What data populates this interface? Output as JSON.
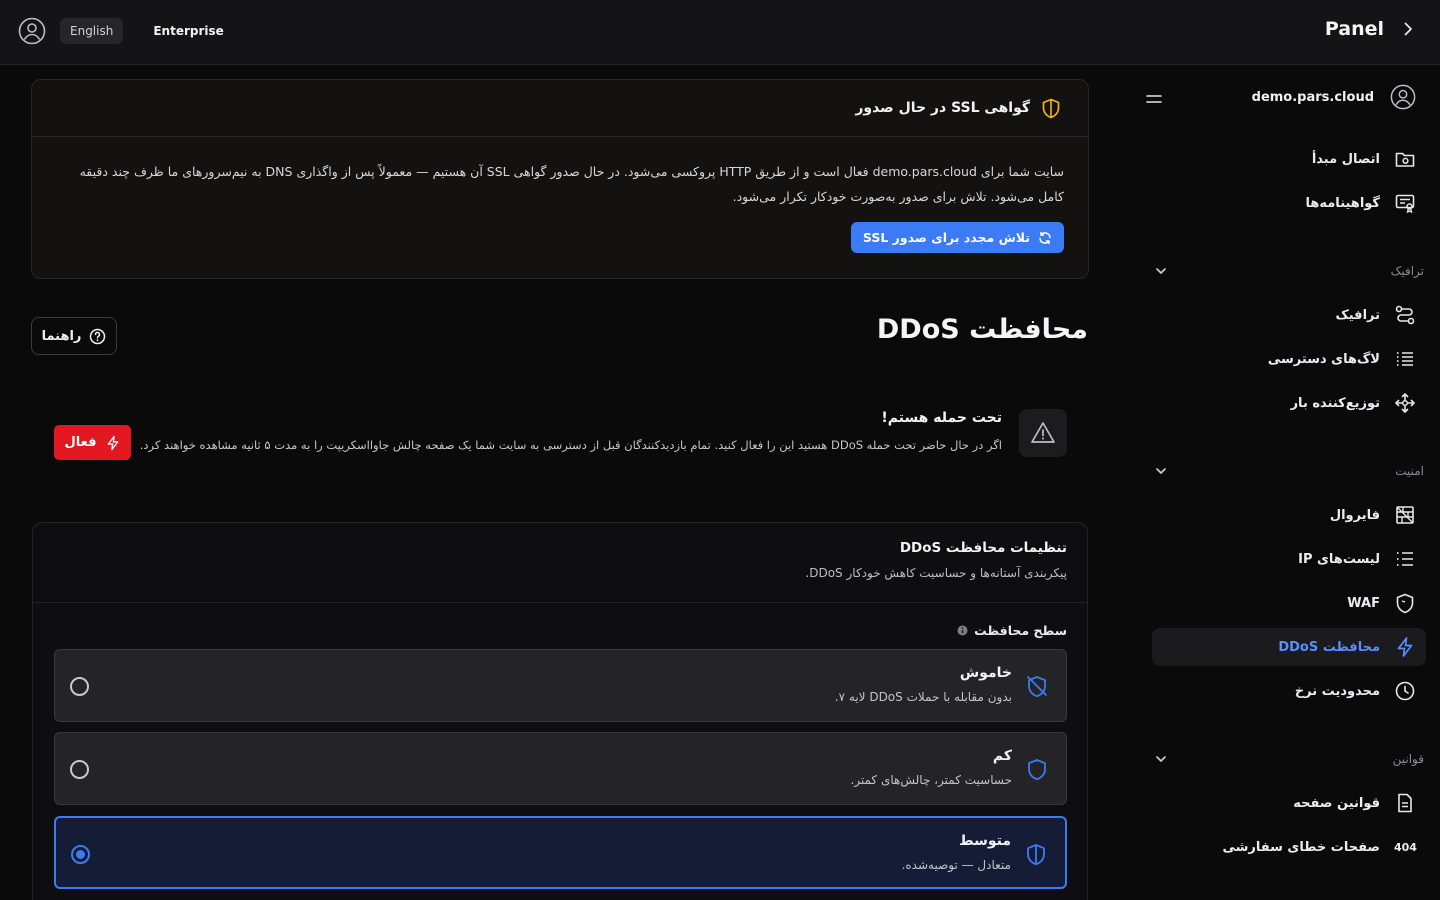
{
  "topbar": {
    "language": "English",
    "plan": "Enterprise",
    "title": "Panel"
  },
  "sidebar": {
    "domain": "demo.pars.cloud",
    "items": [
      {
        "label": "اتصال مبدأ",
        "icon": "folder-link-icon"
      },
      {
        "label": "گواهینامه‌ها",
        "icon": "certificate-icon"
      },
      {
        "label": "ترافیک",
        "icon": "route-icon"
      },
      {
        "label": "لاگ‌های دسترسی",
        "icon": "list-icon"
      },
      {
        "label": "توزیع‌کننده بار",
        "icon": "move-arrows-icon"
      },
      {
        "label": "فایروال",
        "icon": "firewall-icon"
      },
      {
        "label": "لیست‌های IP",
        "icon": "list-icon"
      },
      {
        "label": "WAF",
        "icon": "shield-icon"
      },
      {
        "label": "محافظت DDoS",
        "icon": "bolt-icon"
      },
      {
        "label": "محدودیت نرخ",
        "icon": "clock-icon"
      },
      {
        "label": "قوانین صفحه",
        "icon": "document-icon"
      },
      {
        "label": "صفحات خطای سفارشی",
        "icon": "404-icon",
        "badge": "404"
      }
    ],
    "groups": [
      "ترافیک",
      "امنیت",
      "قوانین"
    ]
  },
  "ssl_notice": {
    "title": "گواهی SSL در حال صدور",
    "body_line1": "سایت شما برای demo.pars.cloud فعال است و از طریق HTTP پروکسی می‌شود. در حال صدور گواهی SSL آن هستیم — معمولاً پس از واگذاری DNS به نیم‌سرورهای ما ظرف چند دقیقه",
    "body_line2": "کامل می‌شود. تلاش برای صدور به‌صورت خودکار تکرار می‌شود.",
    "retry_label": "تلاش مجدد برای صدور SSL"
  },
  "page": {
    "title": "محافظت DDoS",
    "help_label": "راهنما"
  },
  "under_attack": {
    "title": "تحت حمله هستم!",
    "description": "اگر در حال حاضر تحت حمله DDoS هستید این را فعال کنید. تمام بازدیدکنندگان قبل از دسترسی به سایت شما یک صفحه چالش جاوااسکریپت را به مدت ۵ ثانیه مشاهده خواهند کرد.",
    "button_label": "فعال"
  },
  "settings": {
    "title": "تنظیمات محافظت DDoS",
    "subtitle": "پیکربندی آستانه‌ها و حساسیت کاهش خودکار DDoS.",
    "level_label": "سطح محافظت",
    "options": [
      {
        "title": "خاموش",
        "description": "بدون مقابله با حملات DDoS لایه ۷.",
        "selected": false
      },
      {
        "title": "کم",
        "description": "حساسیت کمتر، چالش‌های کمتر.",
        "selected": false
      },
      {
        "title": "متوسط",
        "description": "متعادل — توصیه‌شده.",
        "selected": true
      }
    ]
  },
  "colors": {
    "accent": "#3b7bf6",
    "danger": "#e3171f",
    "warning_icon": "#f5b400"
  }
}
